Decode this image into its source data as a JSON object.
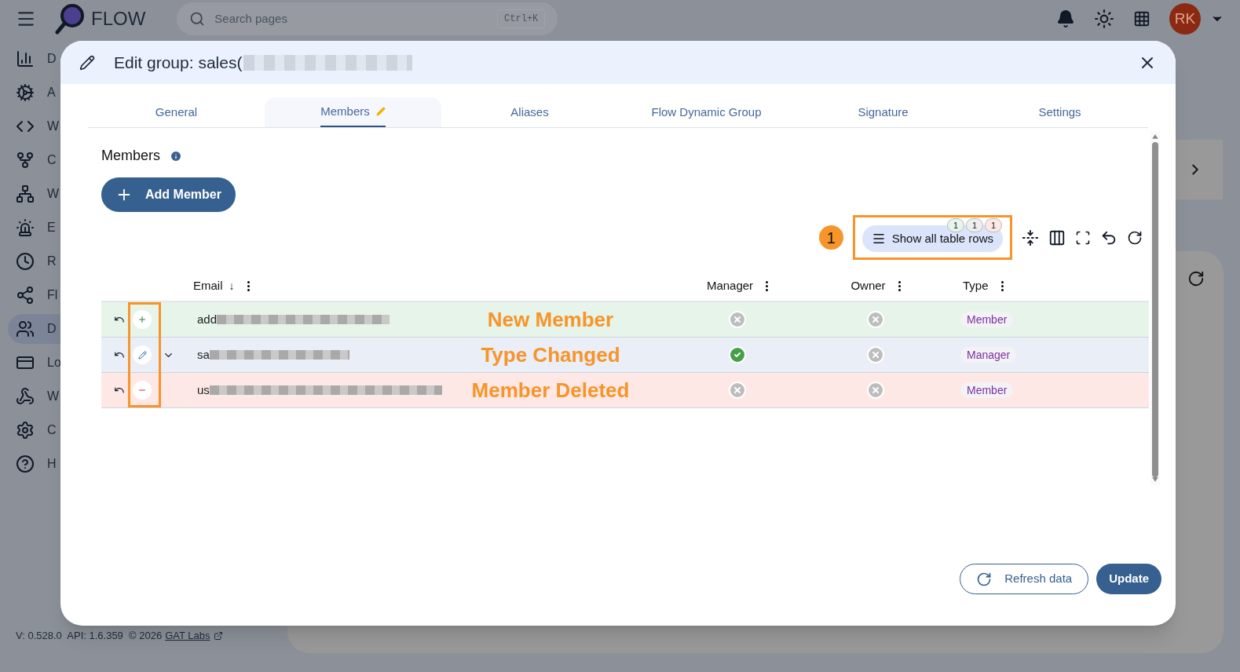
{
  "topbar": {
    "app_name": "FLOW",
    "search": {
      "placeholder": "Search pages",
      "shortcut": "Ctrl+K"
    },
    "avatar": "RK"
  },
  "sidebar": {
    "items": [
      {
        "label": "D",
        "selected": false
      },
      {
        "label": "A",
        "selected": false
      },
      {
        "label": "W",
        "selected": false
      },
      {
        "label": "C",
        "selected": false
      },
      {
        "label": "W",
        "selected": false
      },
      {
        "label": "E",
        "selected": false
      },
      {
        "label": "R",
        "selected": false
      },
      {
        "label": "Fl",
        "selected": false
      },
      {
        "label": "D",
        "selected": true
      },
      {
        "label": "Lo",
        "selected": false
      },
      {
        "label": "W",
        "selected": false
      },
      {
        "label": "C",
        "selected": false
      },
      {
        "label": "H",
        "selected": false
      }
    ]
  },
  "footer": {
    "version": "V: 0.528.0  API: 1.6.359  © 2026",
    "link": "GAT Labs"
  },
  "dialog": {
    "title": "Edit group: sales(",
    "tabs": [
      {
        "label": "General",
        "selected": false,
        "edited": false
      },
      {
        "label": "Members",
        "selected": true,
        "edited": true
      },
      {
        "label": "Aliases",
        "selected": false,
        "edited": false
      },
      {
        "label": "Flow Dynamic Group",
        "selected": false,
        "edited": false
      },
      {
        "label": "Signature",
        "selected": false,
        "edited": false
      },
      {
        "label": "Settings",
        "selected": false,
        "edited": false
      }
    ],
    "section_title": "Members",
    "add_button": "Add Member",
    "callout_number": "1",
    "show_rows_button": {
      "label": "Show all table rows",
      "counts": [
        {
          "text": "1",
          "color": "#e6f4ea"
        },
        {
          "text": "1",
          "color": "#eeeeee"
        },
        {
          "text": "1",
          "color": "#fde8e6"
        }
      ]
    },
    "columns": [
      {
        "label": "Email",
        "sort_indicator": "↓"
      },
      {
        "label": "Manager"
      },
      {
        "label": "Owner"
      },
      {
        "label": "Type"
      }
    ],
    "rows": [
      {
        "kind": "added",
        "email": "add",
        "expandable": false,
        "annotation": "New Member",
        "manager": false,
        "owner": false,
        "type": "Member"
      },
      {
        "kind": "changed",
        "email": "sa",
        "expandable": true,
        "annotation": "Type Changed",
        "manager": true,
        "owner": false,
        "type": "Manager"
      },
      {
        "kind": "deleted",
        "email": "us",
        "expandable": false,
        "annotation": "Member Deleted",
        "manager": false,
        "owner": false,
        "type": "Member"
      }
    ],
    "buttons": {
      "refresh": "Refresh data",
      "update": "Update"
    }
  }
}
